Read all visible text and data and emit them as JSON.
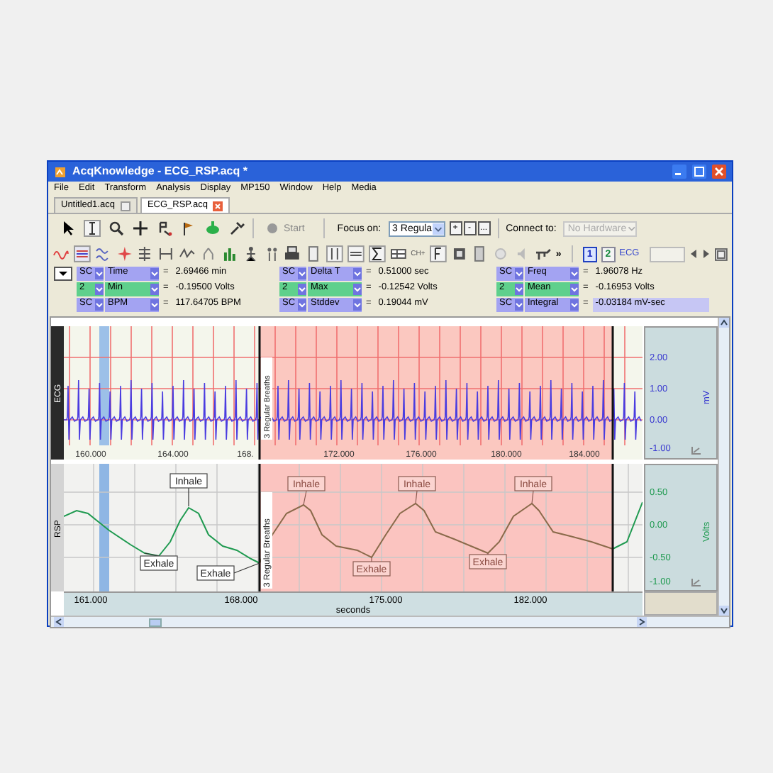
{
  "window": {
    "title": "AcqKnowledge - ECG_RSP.acq *"
  },
  "menu": [
    "File",
    "Edit",
    "Transform",
    "Analysis",
    "Display",
    "MP150",
    "Window",
    "Help",
    "Media"
  ],
  "tabs": [
    {
      "label": "Untitled1.acq",
      "selected": false
    },
    {
      "label": "ECG_RSP.acq",
      "selected": true
    }
  ],
  "toolbar": {
    "start": "Start",
    "focus_label": "Focus on:",
    "focus_value": "3 Regula",
    "focus_buttons": [
      "+",
      "-",
      "..."
    ],
    "connect_label": "Connect to:",
    "connect_value": "No Hardware"
  },
  "toolbar2": {
    "chan_add": "CH+",
    "more": "»",
    "channels": [
      {
        "label": "1",
        "selected": true
      },
      {
        "label": "2",
        "selected": false
      }
    ],
    "channel_name": "ECG"
  },
  "measurements": [
    {
      "items": [
        {
          "source": "SC",
          "name": "Time",
          "sign": "=",
          "value": "2.69466 min",
          "color": "#a3a3f2",
          "selected": false
        },
        {
          "source": "SC",
          "name": "Delta T",
          "sign": "=",
          "value": "0.51000 sec",
          "color": "#a3a3f2",
          "selected": false
        },
        {
          "source": "SC",
          "name": "Freq",
          "sign": "=",
          "value": "1.96078 Hz",
          "color": "#a3a3f2",
          "selected": false
        }
      ]
    },
    {
      "items": [
        {
          "source": "2",
          "name": "Min",
          "sign": "=",
          "value": "-0.19500 Volts",
          "color": "#5fd08c",
          "selected": false
        },
        {
          "source": "2",
          "name": "Max",
          "sign": "=",
          "value": "-0.12542 Volts",
          "color": "#5fd08c",
          "selected": false
        },
        {
          "source": "2",
          "name": "Mean",
          "sign": "=",
          "value": "-0.16953 Volts",
          "color": "#5fd08c",
          "selected": false
        }
      ]
    },
    {
      "items": [
        {
          "source": "SC",
          "name": "BPM",
          "sign": "=",
          "value": "117.64705 BPM",
          "color": "#a3a3f2",
          "selected": false
        },
        {
          "source": "SC",
          "name": "Stddev",
          "sign": "=",
          "value": "0.19044 mV",
          "color": "#a3a3f2",
          "selected": false
        },
        {
          "source": "SC",
          "name": "Integral",
          "sign": "=",
          "value": "-0.03184 mV-sec",
          "color": "#a3a3f2",
          "selected": true
        }
      ]
    }
  ],
  "plots": [
    {
      "label": "ECG",
      "unit": "mV",
      "yticks": [
        "2.00",
        "1.00",
        "0.00",
        "-1.00"
      ],
      "xticks": [
        "160.000",
        "164.000",
        "168.",
        "172.000",
        "176.000",
        "180.000",
        "184.000"
      ],
      "region_label": "3 Regular Breaths"
    },
    {
      "label": "RSP",
      "unit": "Volts",
      "yticks": [
        "0.50",
        "0.00",
        "-0.50",
        "-1.00"
      ],
      "region_label": "3 Regular Breaths",
      "annotations": [
        {
          "text": "Inhale"
        },
        {
          "text": "Exhale"
        },
        {
          "text": "Exhale"
        },
        {
          "text": "Inhale"
        },
        {
          "text": "Exhale"
        },
        {
          "text": "Inhale"
        },
        {
          "text": "Exhale"
        },
        {
          "text": "Inhale"
        }
      ]
    }
  ],
  "x_axis": {
    "ticks": [
      "161.000",
      "168.000",
      "175.000",
      "182.000"
    ],
    "label": "seconds"
  }
}
